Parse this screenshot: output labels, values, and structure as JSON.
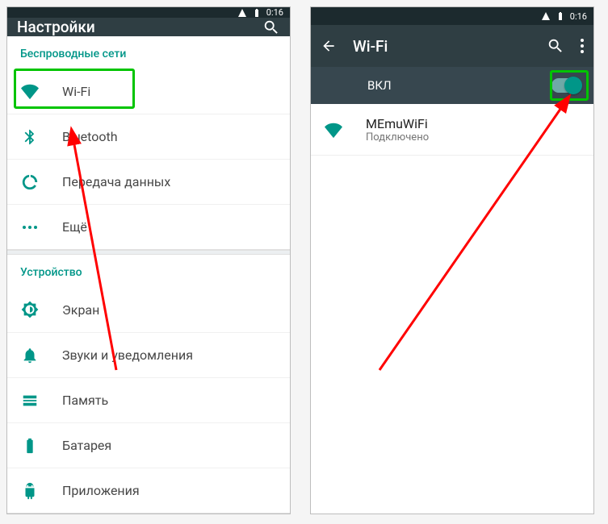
{
  "statusbar": {
    "time": "0:16"
  },
  "left": {
    "title": "Настройки",
    "sections": {
      "wireless": {
        "header": "Беспроводные сети",
        "items": {
          "wifi": "Wi-Fi",
          "bluetooth": "Bluetooth",
          "data": "Передача данных",
          "more": "Ещё"
        }
      },
      "device": {
        "header": "Устройство",
        "items": {
          "display": "Экран",
          "sound": "Звуки и уведомления",
          "memory": "Память",
          "battery": "Батарея",
          "apps": "Приложения"
        }
      }
    }
  },
  "right": {
    "title": "Wi-Fi",
    "switch_label": "ВКЛ",
    "network": {
      "name": "MEmuWiFi",
      "status": "Подключено"
    }
  }
}
